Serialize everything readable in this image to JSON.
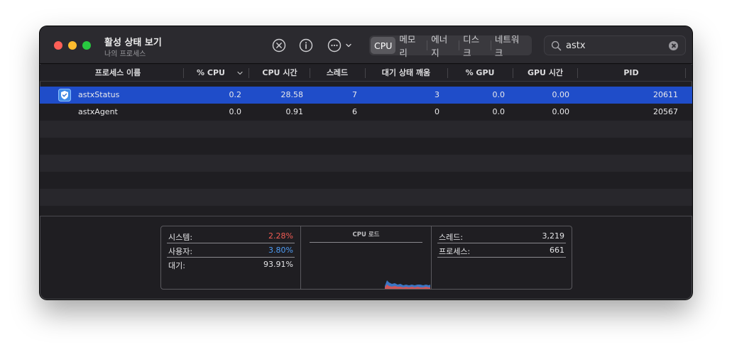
{
  "window": {
    "title": "활성 상태 보기",
    "subtitle": "나의 프로세스"
  },
  "toolbar": {
    "icons": [
      "stop-process-icon",
      "info-icon",
      "more-options-icon"
    ],
    "tabs": [
      {
        "label": "CPU",
        "active": true
      },
      {
        "label": "메모리",
        "active": false
      },
      {
        "label": "에너지",
        "active": false
      },
      {
        "label": "디스크",
        "active": false
      },
      {
        "label": "네트워크",
        "active": false
      }
    ],
    "search": {
      "value": "astx",
      "icon": "search-icon"
    }
  },
  "table": {
    "columns": [
      "프로세스 이름",
      "% CPU",
      "CPU 시간",
      "스레드",
      "대기 상태 깨움",
      "% GPU",
      "GPU 시간",
      "PID"
    ],
    "sort_column": "% CPU",
    "rows": [
      {
        "name": "astxStatus",
        "icon": "shield-check-icon",
        "cpu": "0.2",
        "cpu_time": "28.58",
        "threads": "7",
        "idle_wakeups": "3",
        "gpu": "0.0",
        "gpu_time": "0.00",
        "pid": "20611",
        "selected": true
      },
      {
        "name": "astxAgent",
        "icon": "",
        "cpu": "0.0",
        "cpu_time": "0.91",
        "threads": "6",
        "idle_wakeups": "0",
        "gpu": "0.0",
        "gpu_time": "0.00",
        "pid": "20567",
        "selected": false
      }
    ]
  },
  "stats": {
    "system_label": "시스템:",
    "system_value": "2.28%",
    "system_color": "#f25c54",
    "user_label": "사용자:",
    "user_value": "3.80%",
    "user_color": "#4d9cf5",
    "idle_label": "대기:",
    "idle_value": "93.91%",
    "graph_title": "CPU 로드",
    "threads_label": "스레드:",
    "threads_value": "3,219",
    "processes_label": "프로세스:",
    "processes_value": "661"
  }
}
